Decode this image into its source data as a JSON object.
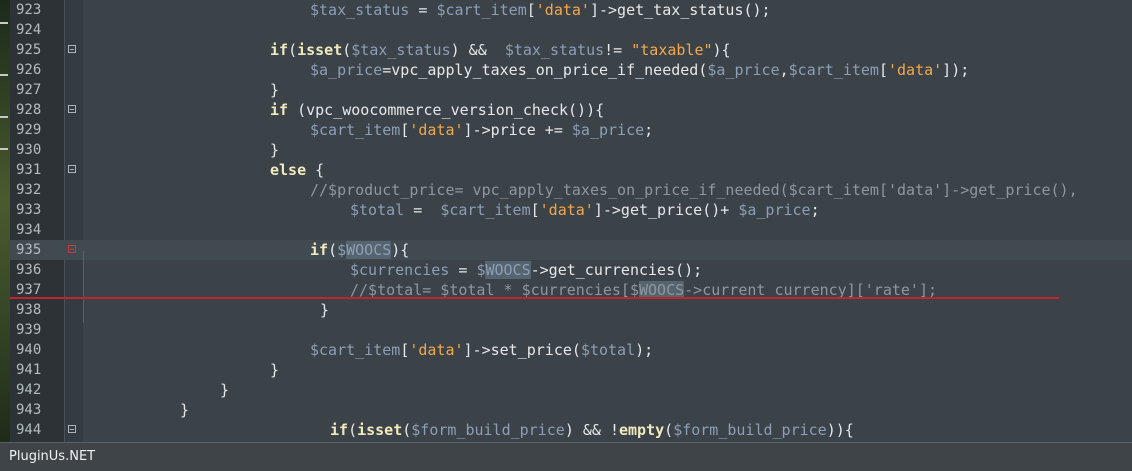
{
  "footer": {
    "brand": "PluginUs.NET"
  },
  "colors": {
    "keyword": "#f0e9bd",
    "variable": "#8c9fb8",
    "string": "#f3a94b",
    "comment": "#8f979c",
    "plain": "#e6e8ea",
    "annotation_line": "#c0252b"
  },
  "editor": {
    "lines": [
      {
        "num": "923",
        "indent": 29,
        "tokens": [
          {
            "t": "$tax_status",
            "c": "v"
          },
          {
            "t": " = "
          },
          {
            "t": "$cart_item",
            "c": "v"
          },
          {
            "t": "["
          },
          {
            "t": "'data'",
            "c": "s"
          },
          {
            "t": "]->get_tax_status();"
          }
        ]
      },
      {
        "num": "924",
        "indent": 0,
        "tokens": []
      },
      {
        "num": "925",
        "indent": 25,
        "fold": true,
        "tokens": [
          {
            "t": "if",
            "c": "k"
          },
          {
            "t": "("
          },
          {
            "t": "isset",
            "c": "k"
          },
          {
            "t": "("
          },
          {
            "t": "$tax_status",
            "c": "v"
          },
          {
            "t": ") &&  "
          },
          {
            "t": "$tax_status",
            "c": "v"
          },
          {
            "t": "!= "
          },
          {
            "t": "\"taxable\"",
            "c": "s"
          },
          {
            "t": "){"
          }
        ]
      },
      {
        "num": "926",
        "indent": 29,
        "tokens": [
          {
            "t": "$a_price",
            "c": "v"
          },
          {
            "t": "=vpc_apply_taxes_on_price_if_needed("
          },
          {
            "t": "$a_price",
            "c": "v"
          },
          {
            "t": ","
          },
          {
            "t": "$cart_item",
            "c": "v"
          },
          {
            "t": "["
          },
          {
            "t": "'data'",
            "c": "s"
          },
          {
            "t": "]);"
          }
        ]
      },
      {
        "num": "927",
        "indent": 25,
        "tokens": [
          {
            "t": "}"
          }
        ]
      },
      {
        "num": "928",
        "indent": 25,
        "fold": true,
        "tokens": [
          {
            "t": "if",
            "c": "k"
          },
          {
            "t": " (vpc_woocommerce_version_check()){"
          }
        ]
      },
      {
        "num": "929",
        "indent": 29,
        "tokens": [
          {
            "t": "$cart_item",
            "c": "v"
          },
          {
            "t": "["
          },
          {
            "t": "'data'",
            "c": "s"
          },
          {
            "t": "]->price += "
          },
          {
            "t": "$a_price",
            "c": "v"
          },
          {
            "t": ";"
          }
        ]
      },
      {
        "num": "930",
        "indent": 25,
        "tokens": [
          {
            "t": "}"
          }
        ]
      },
      {
        "num": "931",
        "indent": 25,
        "fold": true,
        "tokens": [
          {
            "t": "else",
            "c": "k"
          },
          {
            "t": " {"
          }
        ]
      },
      {
        "num": "932",
        "indent": 29,
        "tokens": [
          {
            "t": "//$product_price= vpc_apply_taxes_on_price_if_needed($cart_item['data']->get_price(),",
            "c": "c"
          }
        ]
      },
      {
        "num": "933",
        "indent": 33,
        "tokens": [
          {
            "t": "$total",
            "c": "v"
          },
          {
            "t": " =  "
          },
          {
            "t": "$cart_item",
            "c": "v"
          },
          {
            "t": "["
          },
          {
            "t": "'data'",
            "c": "s"
          },
          {
            "t": "]->get_price()+ "
          },
          {
            "t": "$a_price",
            "c": "v"
          },
          {
            "t": ";"
          }
        ]
      },
      {
        "num": "934",
        "indent": 0,
        "tokens": []
      },
      {
        "num": "935",
        "indent": 29,
        "fold": true,
        "foldRed": true,
        "current": true,
        "tokens": [
          {
            "t": "if",
            "c": "k"
          },
          {
            "t": "("
          },
          {
            "t": "$",
            "c": "v"
          },
          {
            "t": "WOOCS",
            "c": "v",
            "hl": true
          },
          {
            "t": "){"
          }
        ]
      },
      {
        "num": "936",
        "indent": 33,
        "tokens": [
          {
            "t": "$currencies",
            "c": "v"
          },
          {
            "t": " = "
          },
          {
            "t": "$",
            "c": "v"
          },
          {
            "t": "WOOCS",
            "c": "v",
            "hl": true
          },
          {
            "t": "->get_currencies();"
          }
        ]
      },
      {
        "num": "937",
        "indent": 33,
        "tokens": [
          {
            "t": "//$total= $total * $currencies[$",
            "c": "c"
          },
          {
            "t": "WOOCS",
            "c": "c",
            "hl": true
          },
          {
            "t": "->current_currency]['rate'];",
            "c": "c"
          }
        ]
      },
      {
        "num": "938",
        "indent": 30,
        "tokens": [
          {
            "t": "}"
          }
        ]
      },
      {
        "num": "939",
        "indent": 0,
        "tokens": []
      },
      {
        "num": "940",
        "indent": 29,
        "tokens": [
          {
            "t": "$cart_item",
            "c": "v"
          },
          {
            "t": "["
          },
          {
            "t": "'data'",
            "c": "s"
          },
          {
            "t": "]->set_price("
          },
          {
            "t": "$total",
            "c": "v"
          },
          {
            "t": ");"
          }
        ]
      },
      {
        "num": "941",
        "indent": 25,
        "tokens": [
          {
            "t": "}"
          }
        ]
      },
      {
        "num": "942",
        "indent": 20,
        "tokens": [
          {
            "t": "}"
          }
        ]
      },
      {
        "num": "943",
        "indent": 16,
        "tokens": [
          {
            "t": "}"
          }
        ]
      },
      {
        "num": "944",
        "indent": 31,
        "fold": true,
        "tokens": [
          {
            "t": "if",
            "c": "k"
          },
          {
            "t": "("
          },
          {
            "t": "isset",
            "c": "k"
          },
          {
            "t": "("
          },
          {
            "t": "$form_build_price",
            "c": "v"
          },
          {
            "t": ") && !"
          },
          {
            "t": "empty",
            "c": "k"
          },
          {
            "t": "("
          },
          {
            "t": "$form_build_price",
            "c": "v"
          },
          {
            "t": ")){"
          }
        ]
      }
    ]
  }
}
